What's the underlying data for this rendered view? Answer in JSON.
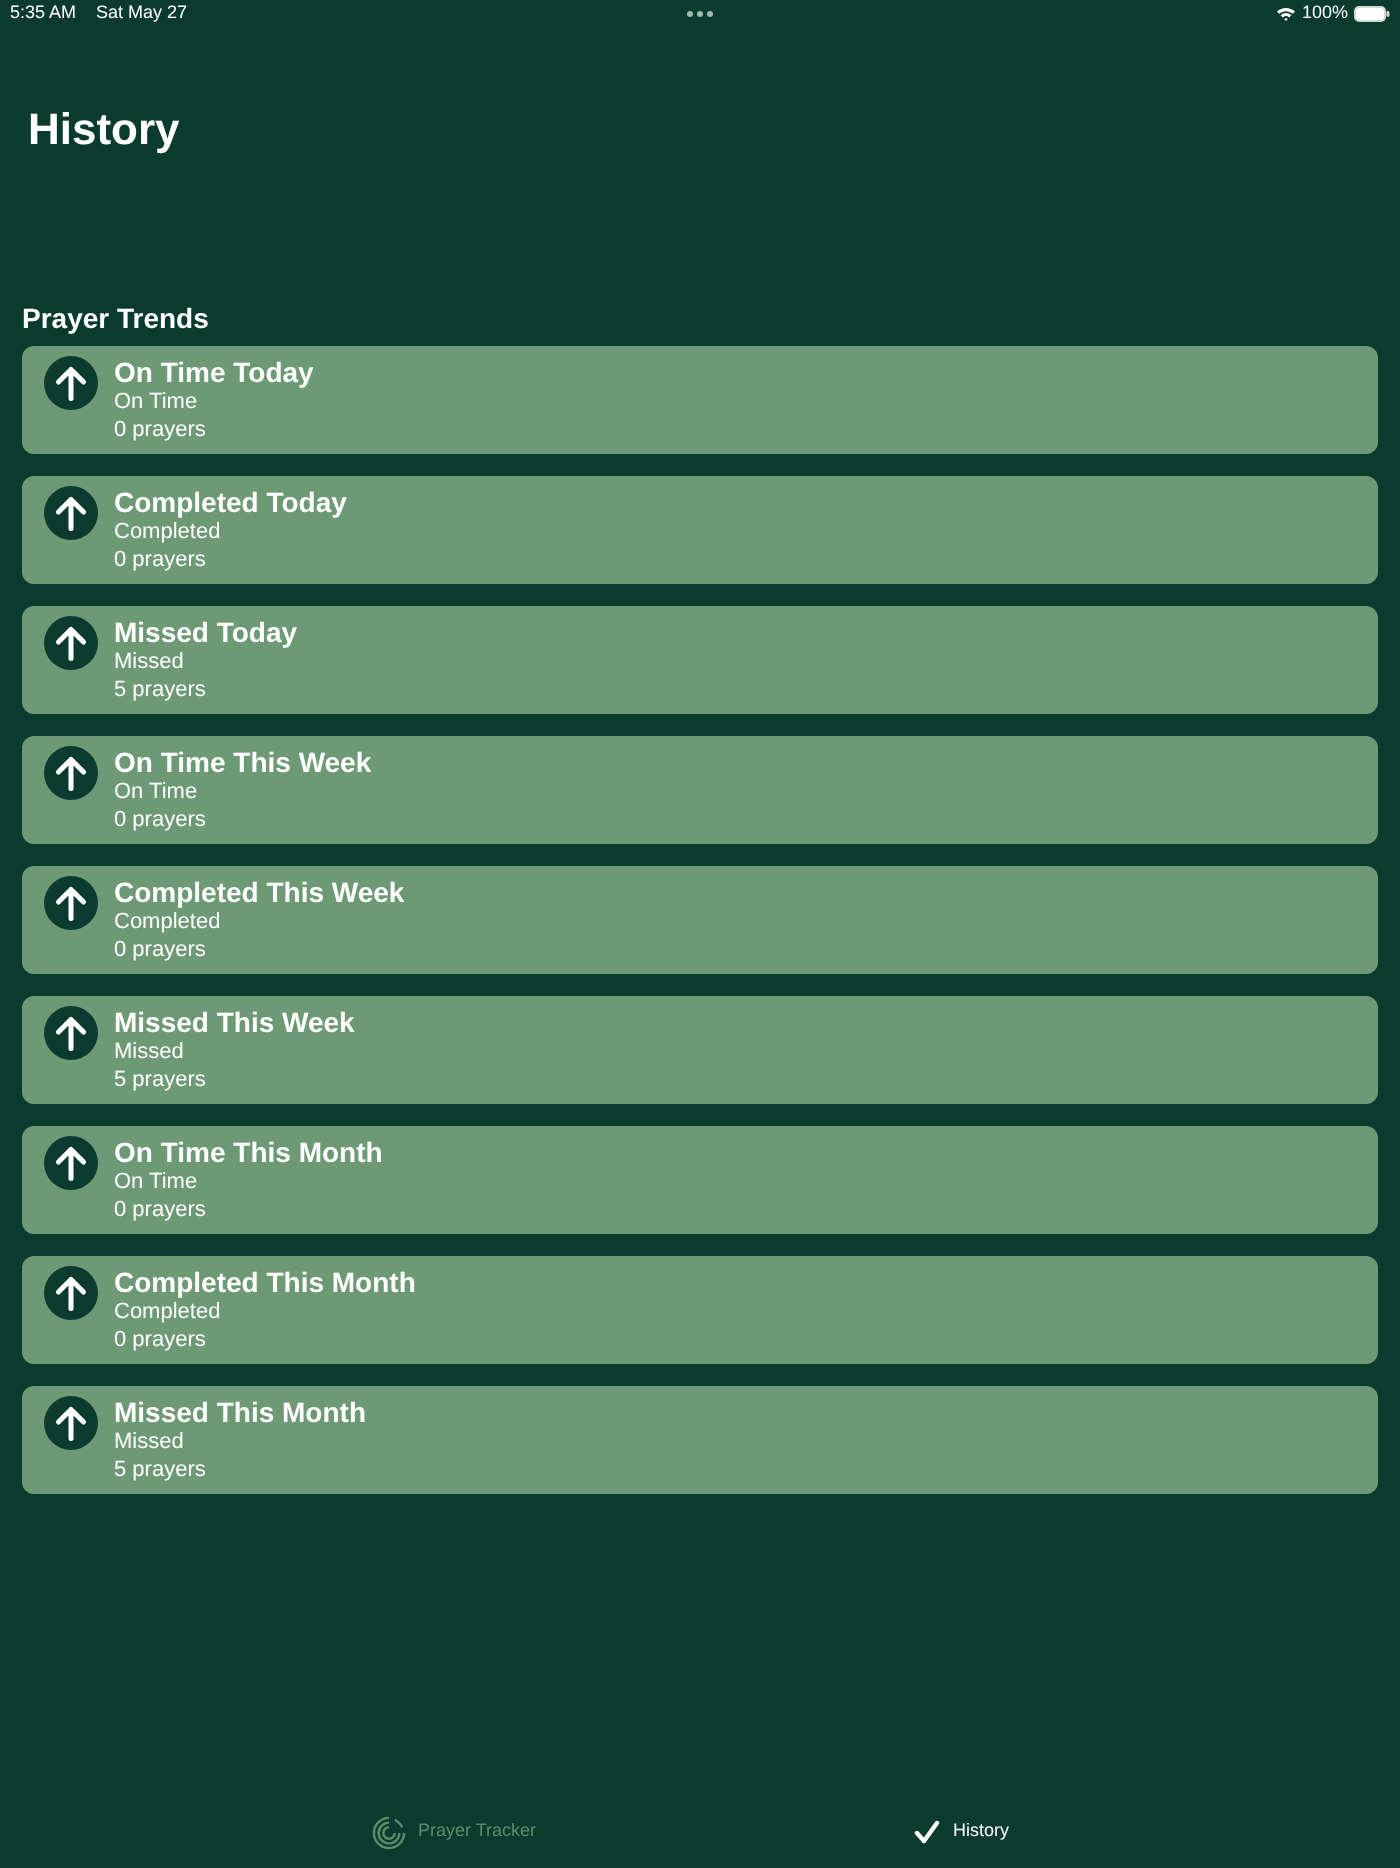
{
  "status_bar": {
    "time": "5:35 AM",
    "date": "Sat May 27",
    "battery": "100%"
  },
  "title": "History",
  "section": {
    "title": "Prayer Trends",
    "items": [
      {
        "title": "On Time Today",
        "status": "On Time",
        "count": "0 prayers"
      },
      {
        "title": "Completed Today",
        "status": "Completed",
        "count": "0 prayers"
      },
      {
        "title": "Missed Today",
        "status": "Missed",
        "count": "5 prayers"
      },
      {
        "title": "On Time This Week",
        "status": "On Time",
        "count": "0 prayers"
      },
      {
        "title": "Completed This Week",
        "status": "Completed",
        "count": "0 prayers"
      },
      {
        "title": "Missed This Week",
        "status": "Missed",
        "count": "5 prayers"
      },
      {
        "title": "On Time This Month",
        "status": "On Time",
        "count": "0 prayers"
      },
      {
        "title": "Completed This Month",
        "status": "Completed",
        "count": "0 prayers"
      },
      {
        "title": "Missed This Month",
        "status": "Missed",
        "count": "5 prayers"
      }
    ]
  },
  "tab_bar": [
    {
      "label": "Prayer Tracker",
      "selected": false,
      "kind": "tracker"
    },
    {
      "label": "History",
      "selected": true,
      "kind": "check"
    }
  ]
}
